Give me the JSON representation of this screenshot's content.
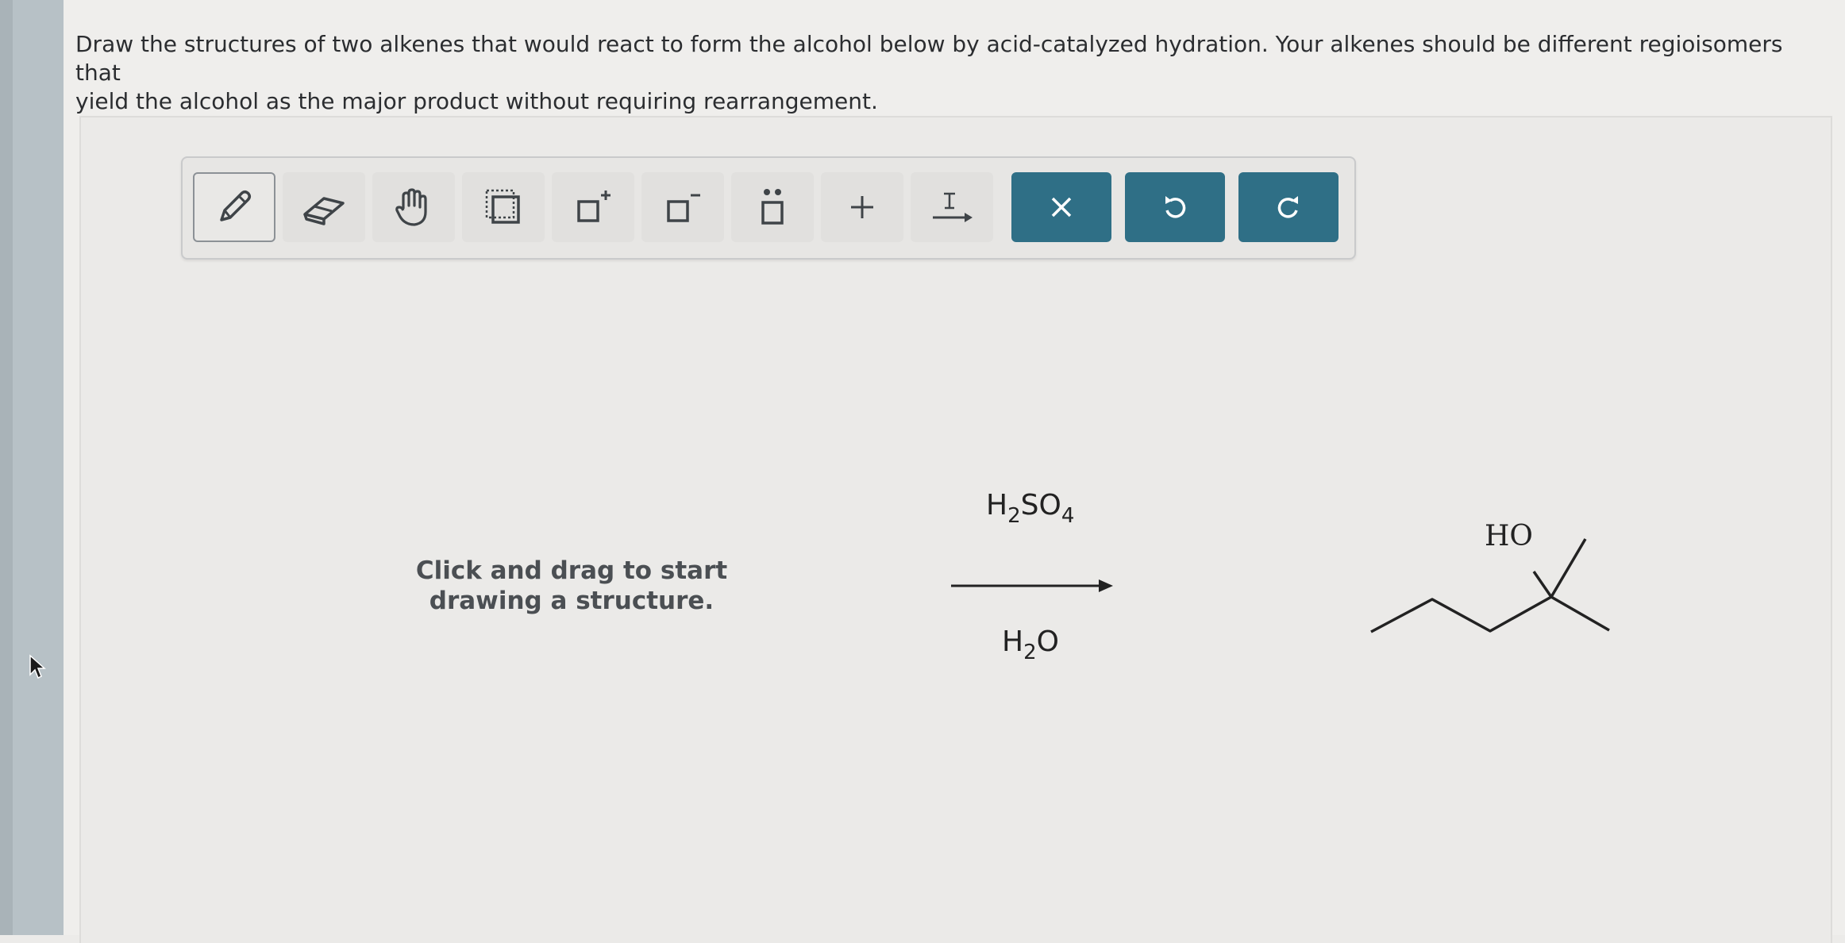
{
  "question": {
    "line1": "Draw the structures of two alkenes that would react to form the alcohol below by acid-catalyzed hydration. Your alkenes should be different regioisomers that",
    "line2": "yield the alcohol as the major product without requiring rearrangement."
  },
  "toolbar": {
    "tools": [
      {
        "name": "draw-tool",
        "icon": "pencil-icon"
      },
      {
        "name": "erase-tool",
        "icon": "eraser-icon"
      },
      {
        "name": "pan-tool",
        "icon": "hand-icon"
      },
      {
        "name": "select-tool",
        "icon": "selection-icon"
      },
      {
        "name": "positive-charge-tool",
        "icon": "charge-plus-icon"
      },
      {
        "name": "negative-charge-tool",
        "icon": "charge-minus-icon"
      },
      {
        "name": "lone-pair-tool",
        "icon": "lone-pair-icon"
      },
      {
        "name": "add-tool",
        "icon": "plus-icon"
      },
      {
        "name": "text-arrow-tool",
        "icon": "text-arrow-icon"
      },
      {
        "name": "clear-button",
        "icon": "x-icon"
      },
      {
        "name": "undo-button",
        "icon": "undo-icon"
      },
      {
        "name": "redo-button",
        "icon": "redo-icon"
      }
    ],
    "accent_color": "#2f6f86"
  },
  "canvas": {
    "hint_line1": "Click and drag to start",
    "hint_line2": "drawing a structure."
  },
  "reaction": {
    "reagent_top": {
      "main1": "H",
      "sub1": "2",
      "main2": "SO",
      "sub2": "4"
    },
    "reagent_bottom": {
      "main1": "H",
      "sub1": "2",
      "main2": "O"
    },
    "product_label": "HO"
  }
}
